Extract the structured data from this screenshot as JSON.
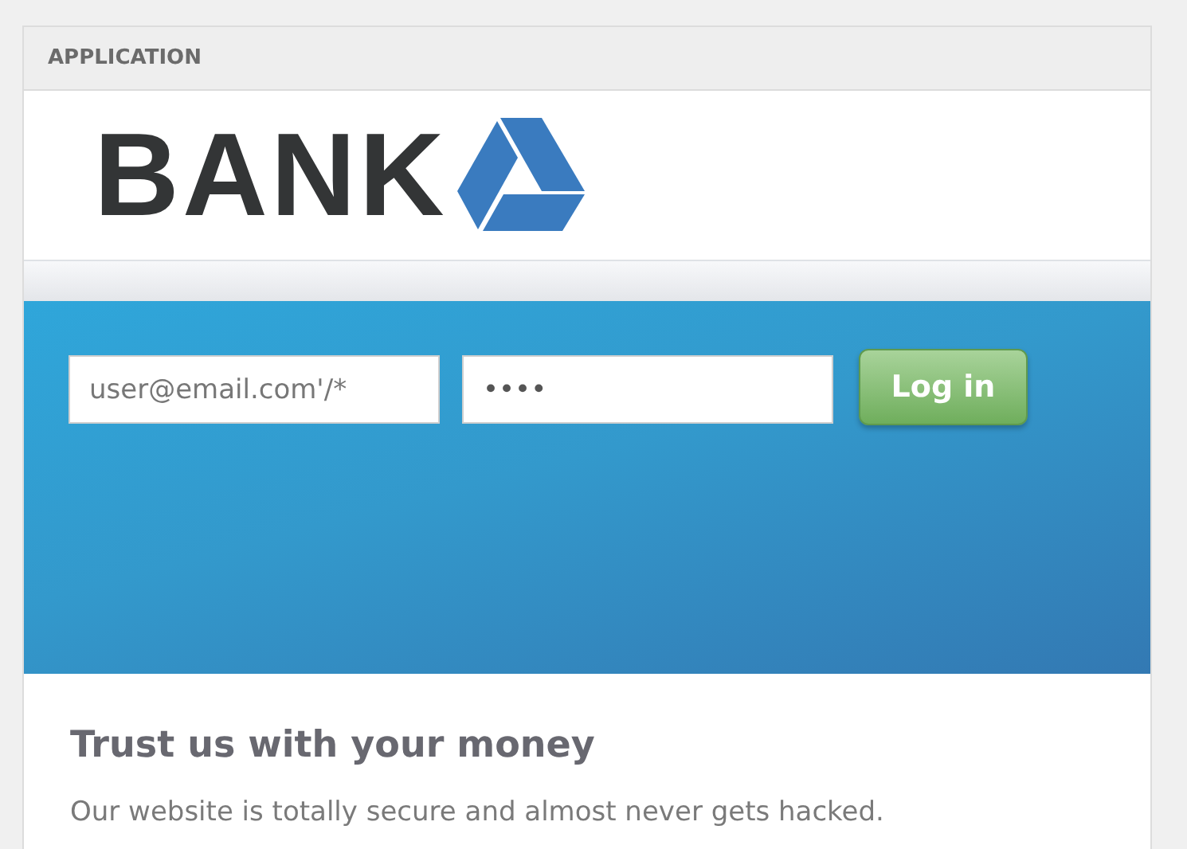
{
  "panel": {
    "title": "APPLICATION"
  },
  "logo": {
    "text": "BANK"
  },
  "login": {
    "email": "user@email.com'/*",
    "password": "••••",
    "button": "Log in"
  },
  "content": {
    "heading": "Trust us with your money",
    "text": "Our website is totally secure and almost never gets hacked."
  }
}
